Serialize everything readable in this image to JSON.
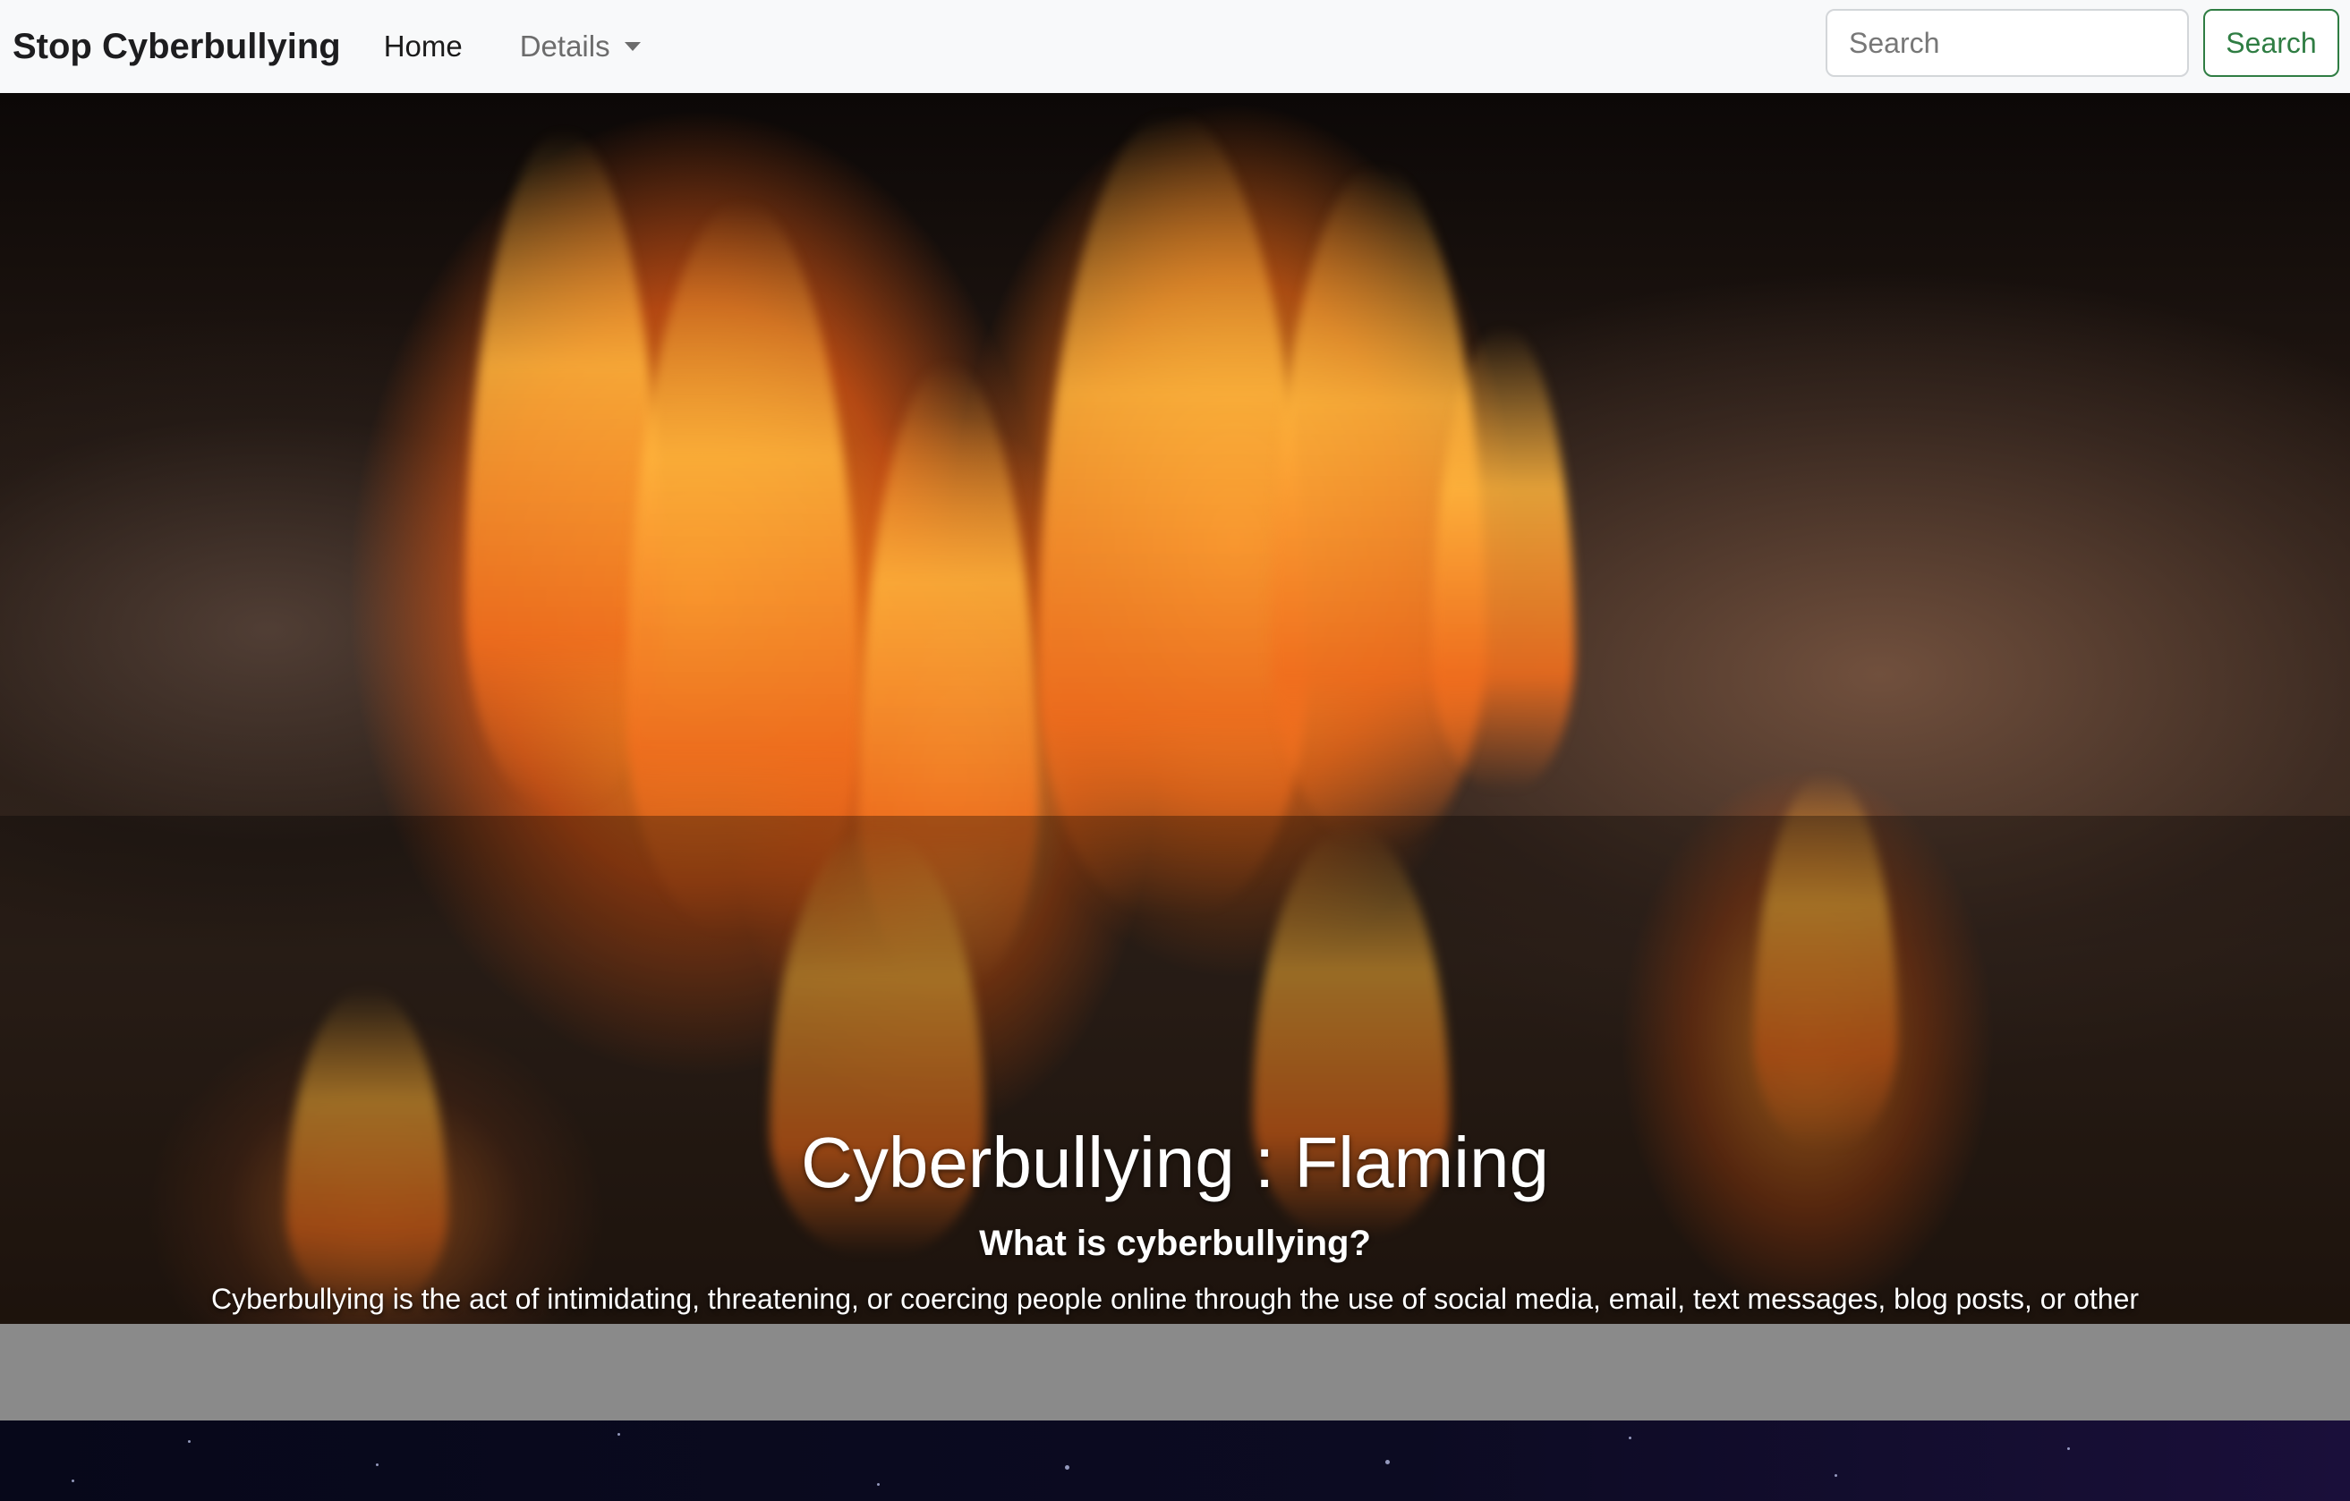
{
  "navbar": {
    "brand": "Stop Cyberbullying",
    "home_label": "Home",
    "details_label": "Details",
    "search_placeholder": "Search",
    "search_button_label": "Search"
  },
  "hero": {
    "title": "Cyberbullying : Flaming",
    "subtitle": "What is cyberbullying?",
    "text": "Cyberbullying is the act of intimidating, threatening, or coercing people online through the use of social media, email, text messages, blog posts, or other digital or electronic methods."
  },
  "colors": {
    "navbar_bg": "#f8f9fa",
    "search_accent": "#2f7d43",
    "gray_band": "#8a8a8a"
  },
  "icons": {
    "details_caret": "caret-down-icon"
  }
}
